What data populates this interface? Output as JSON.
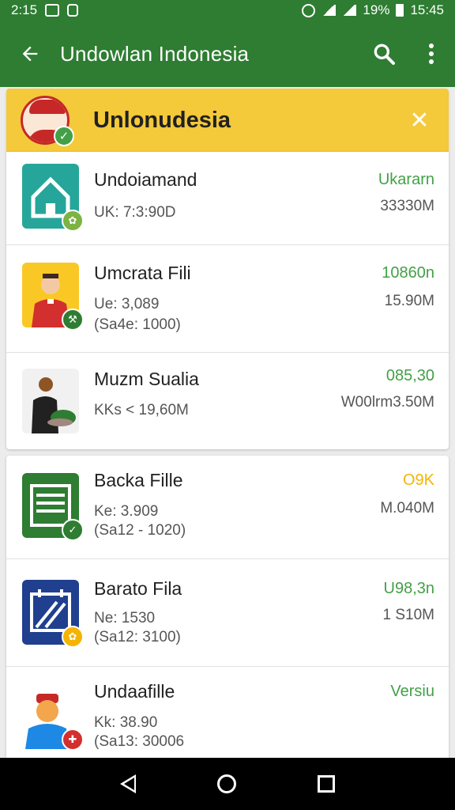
{
  "status_bar": {
    "time_left": "2:15",
    "battery": "19%",
    "clock": "15:45"
  },
  "appbar": {
    "title": "Undowlan Indonesia"
  },
  "banner": {
    "title": "Unlonudesia"
  },
  "group1": [
    {
      "name": "Undoiamand",
      "meta1": "UK: 7:3:90D",
      "meta2": "",
      "status": "Ukararn",
      "size": "33330M",
      "icon": "house-icon",
      "color": "#26a69a"
    },
    {
      "name": "Umcrata Fili",
      "meta1": "Ue: 3,089",
      "meta2": "(Sa4e: 1000)",
      "status": "10860n",
      "size": "15.90M",
      "icon": "person-icon",
      "color": "#f9c825"
    },
    {
      "name": "Muzm Sualia",
      "meta1": "KKs < 19,60M",
      "meta2": "",
      "status": "085,30",
      "size": "W00lrm3.50M",
      "icon": "person-plant-icon",
      "color": "#f1f1f1"
    }
  ],
  "group2": [
    {
      "name": "Backa Fille",
      "meta1": "Ke: 3.909",
      "meta2": "(Sa12 - 1020)",
      "status": "O9K",
      "size": "M.040M",
      "icon": "list-icon",
      "color": "#2e7d32",
      "status_color": "#f4b400"
    },
    {
      "name": "Barato Fila",
      "meta1": "Ne: 1530",
      "meta2": "(Sa12: 3100)",
      "status": "U98,3n",
      "size": "1 S10M",
      "icon": "calendar-icon",
      "color": "#203f8f",
      "status_color": "#43a047"
    },
    {
      "name": "Undaafille",
      "meta1": "Kk: 38.90",
      "meta2": "(Sa13: 30006",
      "status": "Versiu",
      "size": "",
      "icon": "mascot-icon",
      "color": "#ffffff",
      "status_color": "#43a047"
    }
  ]
}
